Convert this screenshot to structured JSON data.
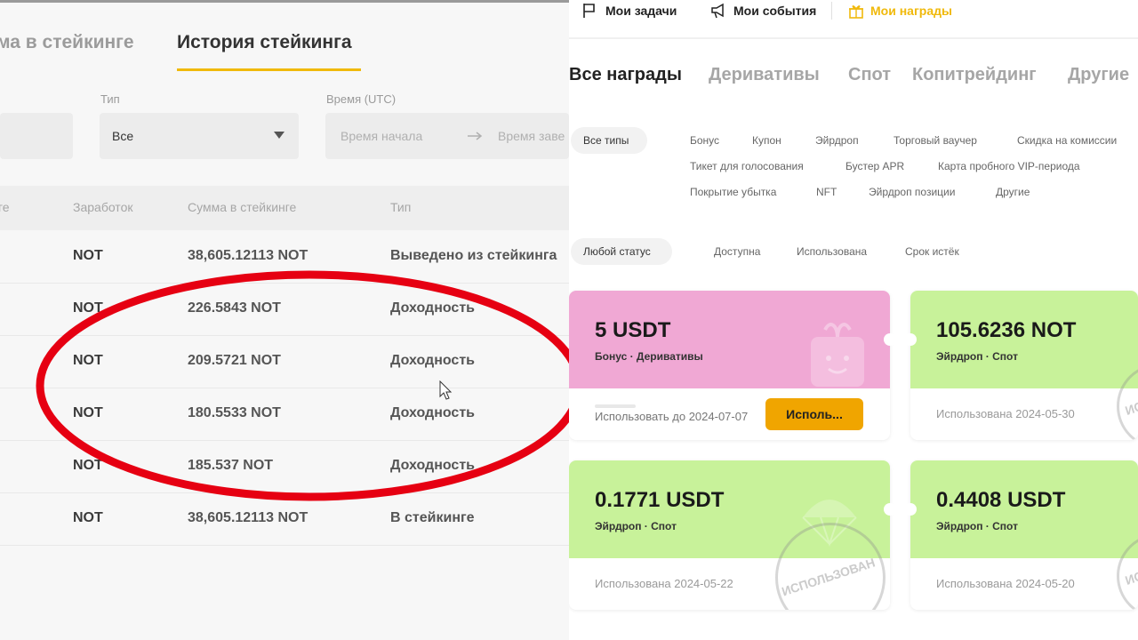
{
  "left": {
    "tabs": [
      "ма в стейкинге",
      "История стейкинга"
    ],
    "filters": {
      "type_label": "Тип",
      "type_value": "Все",
      "time_label": "Время (UTC)",
      "start_placeholder": "Время начала",
      "end_placeholder": "Время заве"
    },
    "columns": [
      "ге",
      "Заработок",
      "Сумма в стейкинге",
      "Тип"
    ],
    "rows": [
      {
        "coin": "NOT",
        "amount": "38,605.12113 NOT",
        "type": "Выведено из стейкинга"
      },
      {
        "coin": "NOT",
        "amount": "226.5843 NOT",
        "type": "Доходность"
      },
      {
        "coin": "NOT",
        "amount": "209.5721 NOT",
        "type": "Доходность"
      },
      {
        "coin": "NOT",
        "amount": "180.5533 NOT",
        "type": "Доходность"
      },
      {
        "coin": "NOT",
        "amount": "185.537 NOT",
        "type": "Доходность"
      },
      {
        "coin": "NOT",
        "amount": "38,605.12113 NOT",
        "type": "В стейкинге"
      }
    ],
    "highlight_color": "#e60012"
  },
  "right": {
    "topbar": [
      "Мои задачи",
      "Мои события",
      "Мои награды"
    ],
    "categories": [
      "Все награды",
      "Деривативы",
      "Спот",
      "Копитрейдинг",
      "Другие"
    ],
    "type_chip": "Все типы",
    "types_row1": [
      "Бонус",
      "Купон",
      "Эйрдроп",
      "Торговый ваучер",
      "Скидка на комиссии"
    ],
    "types_row2": [
      "Тикет для голосования",
      "Бустер APR",
      "Карта пробного VIP-периода"
    ],
    "types_row3": [
      "Покрытие убытка",
      "NFT",
      "Эйрдроп позиции",
      "Другие"
    ],
    "status_chip": "Любой статус",
    "statuses": [
      "Доступна",
      "Использована",
      "Срок истёк"
    ],
    "cards": [
      {
        "amount": "5 USDT",
        "sub": "Бонус · Деривативы",
        "footer": "Использовать до 2024-07-07",
        "button": "Исполь...",
        "color": "#f0a8d4"
      },
      {
        "amount": "105.6236 NOT",
        "sub": "Эйрдроп · Спот",
        "footer": "Использована 2024-05-30",
        "stamp": "ИСПО",
        "color": "#c8f29a"
      },
      {
        "amount": "0.1771 USDT",
        "sub": "Эйрдроп · Спот",
        "footer": "Использована 2024-05-22",
        "stamp": "ИСПОЛЬЗОВАН",
        "color": "#c8f29a"
      },
      {
        "amount": "0.4408 USDT",
        "sub": "Эйрдроп · Спот",
        "footer": "Использована 2024-05-20",
        "stamp": "ИСПО",
        "color": "#c8f29a"
      }
    ],
    "accent": "#f0b90b"
  }
}
